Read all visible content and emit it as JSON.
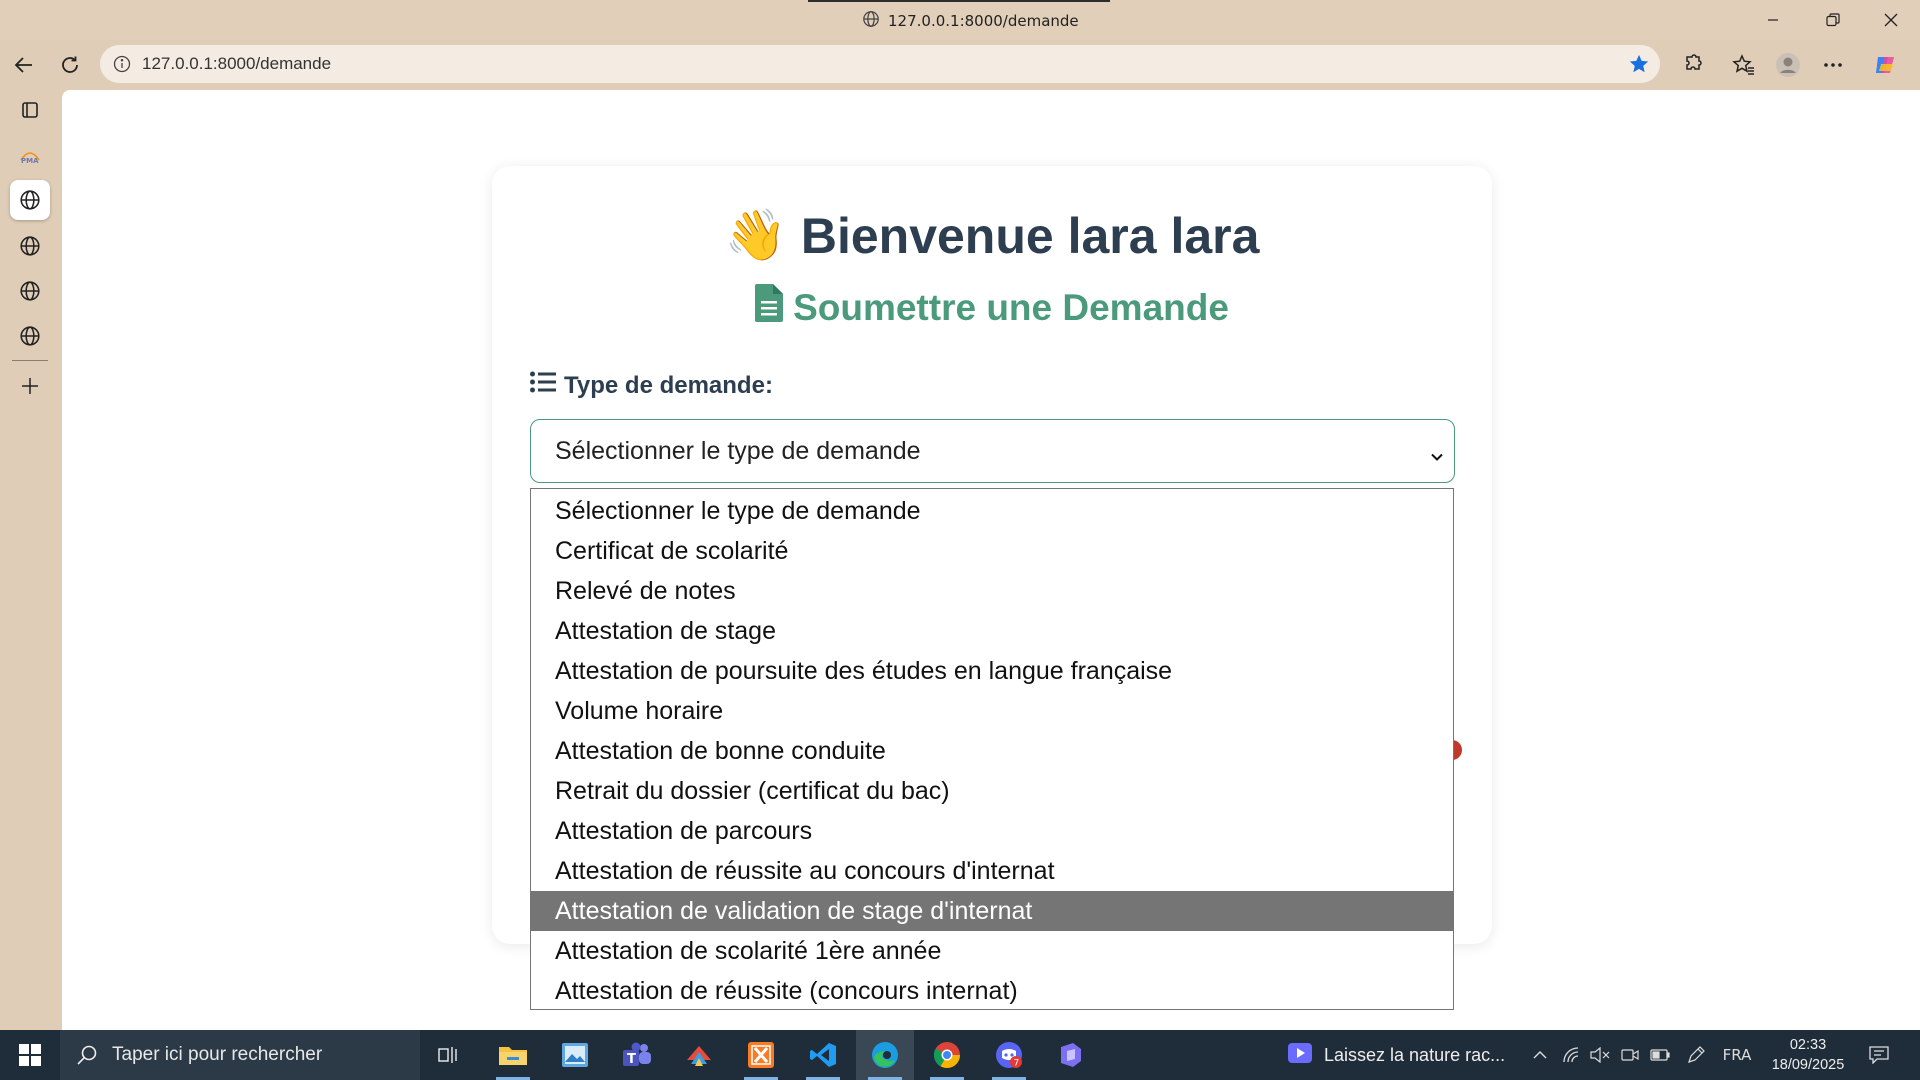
{
  "window": {
    "title": "127.0.0.1:8000/demande"
  },
  "browser": {
    "url": "127.0.0.1:8000/demande"
  },
  "page": {
    "welcome_emoji": "👋",
    "welcome_text": "Bienvenue lara lara",
    "subtitle": "Soumettre une Demande",
    "field_label": "Type de demande:",
    "select_value": "Sélectionner le type de demande",
    "options": [
      "Sélectionner le type de demande",
      "Certificat de scolarité",
      "Relevé de notes",
      "Attestation de stage",
      "Attestation de poursuite des études en langue française",
      "Volume horaire",
      "Attestation de bonne conduite",
      "Retrait du dossier (certificat du bac)",
      "Attestation de parcours",
      "Attestation de réussite au concours d'internat",
      "Attestation de validation de stage d'internat",
      "Attestation de scolarité 1ère année",
      "Attestation de réussite (concours internat)"
    ],
    "highlighted_option_index": 10,
    "colors": {
      "heading": "#2c3e50",
      "accent": "#4a9a7b",
      "highlight": "#757575"
    }
  },
  "taskbar": {
    "search_placeholder": "Taper ici pour rechercher",
    "news_text": "Laissez la nature rac...",
    "language": "FRA",
    "time": "02:33",
    "date": "18/09/2025",
    "chrome_badge": "7"
  }
}
